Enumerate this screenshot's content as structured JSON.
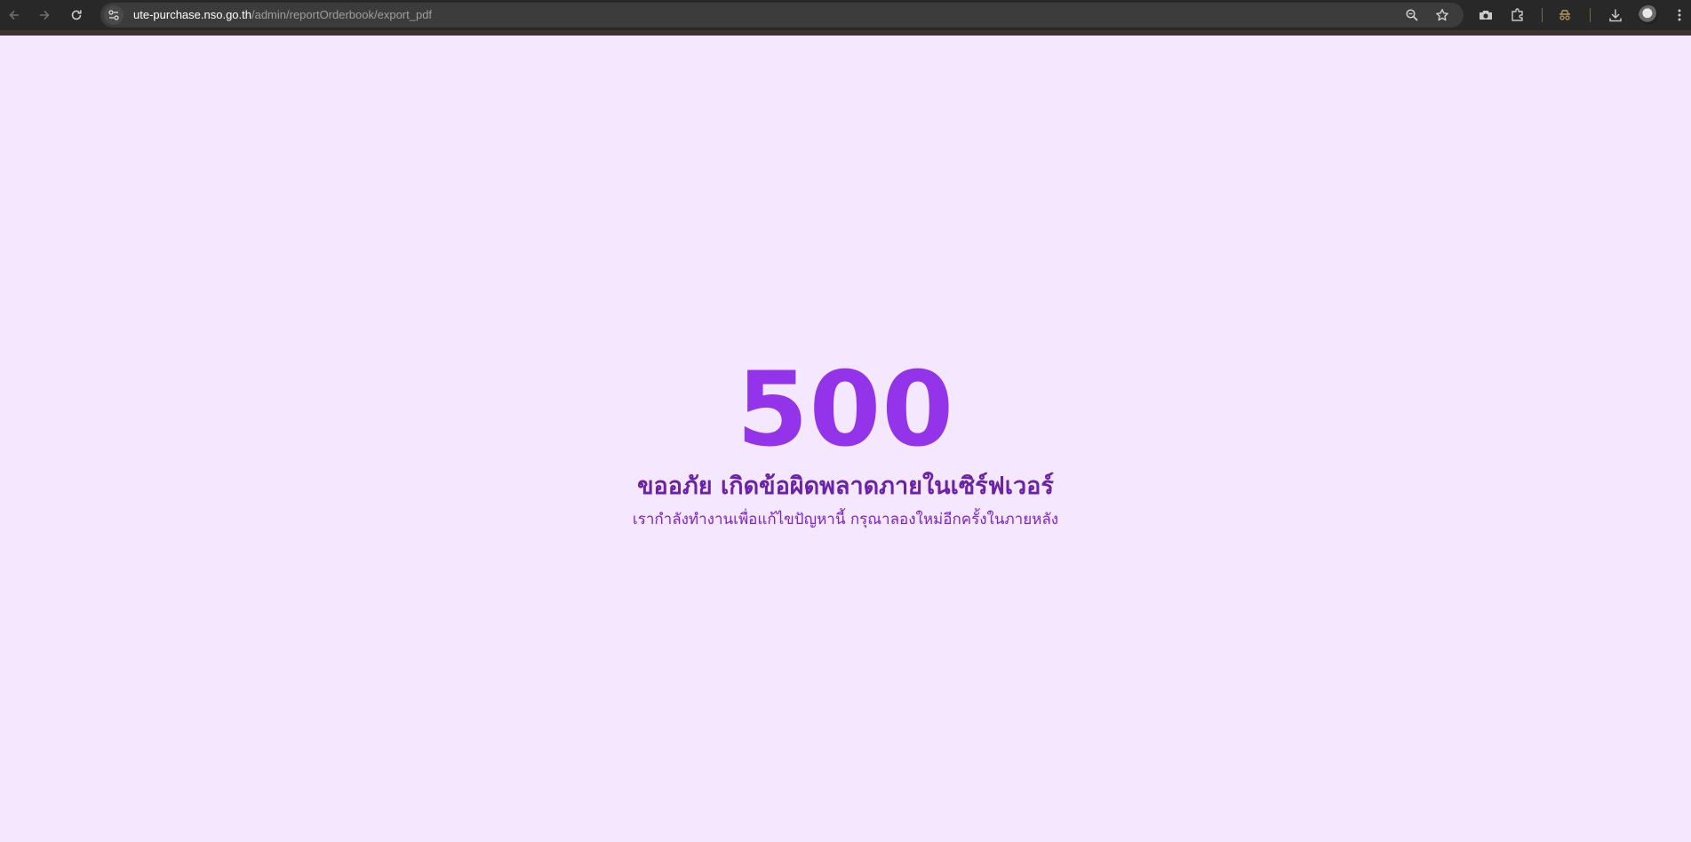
{
  "browser": {
    "url_host": "ute-purchase.nso.go.th",
    "url_path": "/admin/reportOrderbook/export_pdf",
    "icons": {
      "back": "arrow-left-icon",
      "forward": "arrow-right-icon",
      "reload": "reload-icon",
      "site_info": "tune-icon",
      "zoom": "zoom-icon",
      "bookmark": "star-icon",
      "screenshot": "camera-icon",
      "extensions": "puzzle-icon",
      "incognito": "incognito-icon",
      "downloads": "download-icon",
      "menu": "kebab-menu-icon"
    }
  },
  "error": {
    "code": "500",
    "title": "ขออภัย เกิดข้อผิดพลาดภายในเซิร์ฟเวอร์",
    "message": "เรากำลังทำงานเพื่อแก้ไขปัญหานี้ กรุณาลองใหม่อีกครั้งในภายหลัง"
  },
  "colors": {
    "page_background": "#f3e8ff",
    "code": "#9333ea",
    "title": "#6b21a8",
    "message": "#7e22ce",
    "toolbar": "#282828"
  }
}
